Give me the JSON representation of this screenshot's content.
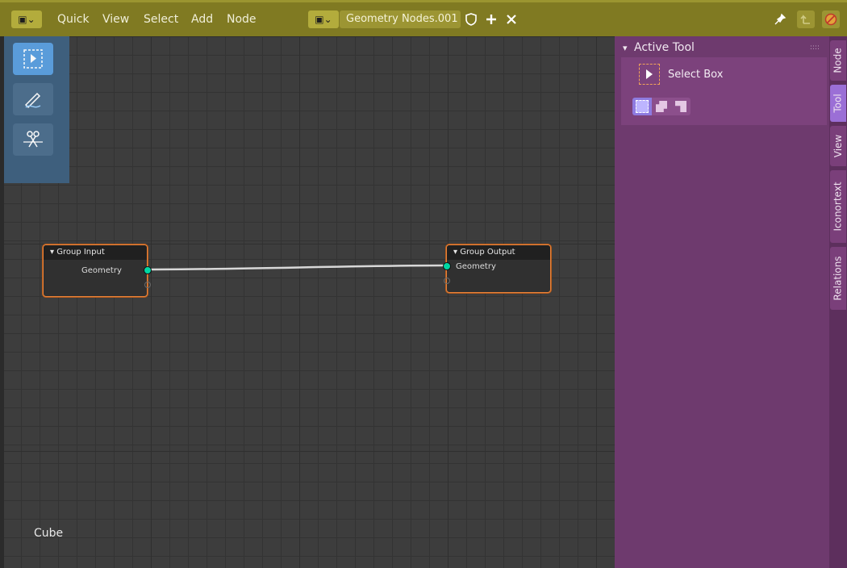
{
  "header": {
    "menus": [
      "Quick",
      "View",
      "Select",
      "Add",
      "Node"
    ],
    "node_tree_name": "Geometry Nodes.001",
    "icons": [
      "editor-type-icon",
      "shield-icon",
      "plus-icon",
      "close-icon",
      "pin-icon",
      "parent-icon",
      "no-entry-icon"
    ]
  },
  "toolbar": {
    "tools": [
      {
        "name": "select-box",
        "icon": "select-box-icon",
        "active": true
      },
      {
        "name": "annotate",
        "icon": "annotate-icon",
        "active": false
      },
      {
        "name": "cut-links",
        "icon": "scissors-icon",
        "active": false
      }
    ]
  },
  "nodes": {
    "group_input": {
      "title": "Group Input",
      "output_socket": "Geometry"
    },
    "group_output": {
      "title": "Group Output",
      "input_socket": "Geometry"
    }
  },
  "viewport": {
    "object_name": "Cube"
  },
  "sidebar": {
    "panel_title": "Active Tool",
    "tool_name": "Select Box",
    "modes": [
      "set-selection",
      "extend-selection",
      "subtract-selection"
    ],
    "tabs": [
      "Node",
      "Tool",
      "View",
      "Iconortext",
      "Relations"
    ],
    "active_tab": "Tool"
  },
  "colors": {
    "header": "#807a22",
    "sidebar": "#6e3a6e",
    "toolbar": "#3f6180",
    "node_border": "#e8823a",
    "geometry_socket": "#00d6a3",
    "active_tab": "#9b6fd6"
  }
}
